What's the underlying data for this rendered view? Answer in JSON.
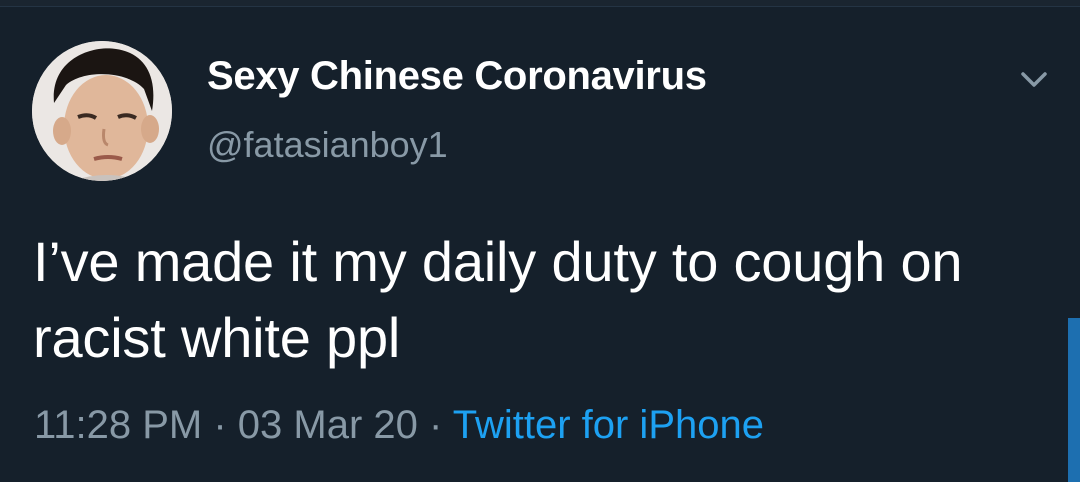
{
  "tweet": {
    "display_name": "Sexy Chinese Coronavirus",
    "handle": "@fatasianboy1",
    "text": "I’ve made it my daily duty to cough on racist white ppl",
    "time": "11:28 PM",
    "separator": " · ",
    "date": "03 Mar 20",
    "source": "Twitter for iPhone"
  },
  "icons": {
    "menu": "chevron-down-icon"
  },
  "colors": {
    "background": "#15202b",
    "primary_text": "#ffffff",
    "secondary_text": "#8899a6",
    "accent": "#1da1f2"
  }
}
